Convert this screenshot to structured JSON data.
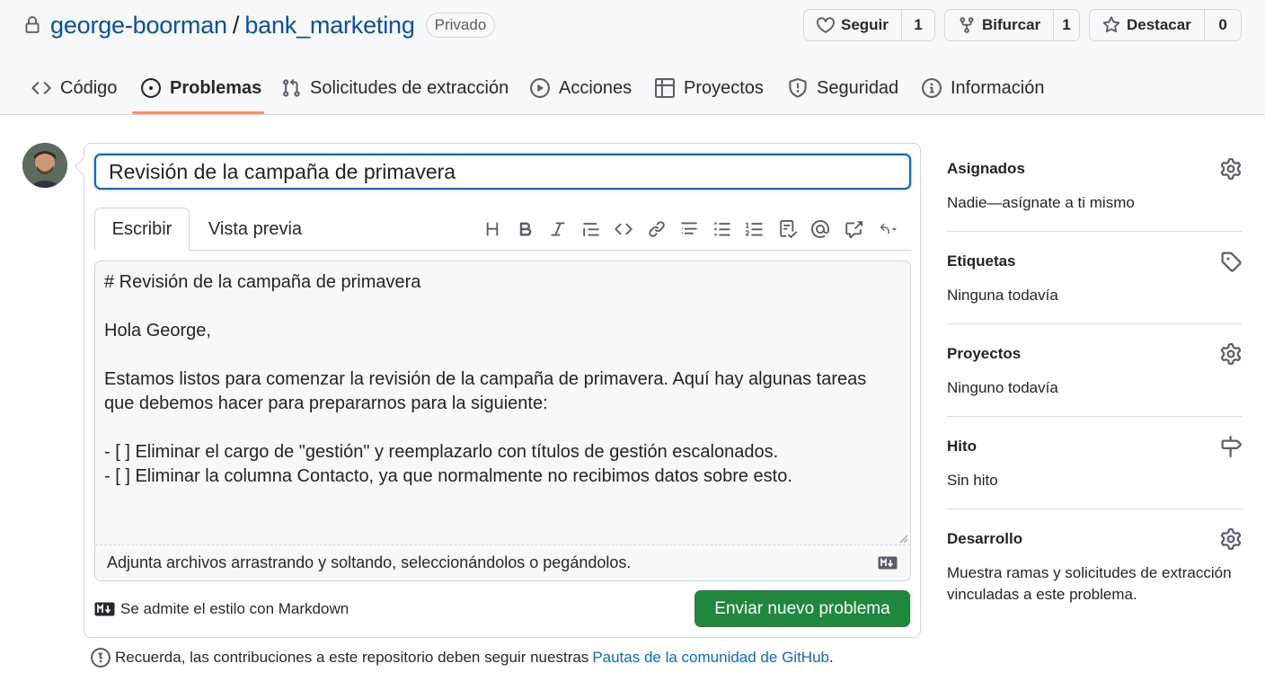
{
  "repo": {
    "owner": "george-boorman",
    "separator": "/",
    "name": "bank_marketing",
    "visibility": "Privado"
  },
  "actions": {
    "watch_label": "Seguir",
    "watch_count": "1",
    "fork_label": "Bifurcar",
    "fork_count": "1",
    "star_label": "Destacar",
    "star_count": "0"
  },
  "tabs": [
    {
      "label": "Código",
      "icon": "code-icon"
    },
    {
      "label": "Problemas",
      "icon": "issue-opened-icon",
      "active": true
    },
    {
      "label": "Solicitudes de extracción",
      "icon": "git-pull-request-icon"
    },
    {
      "label": "Acciones",
      "icon": "play-icon"
    },
    {
      "label": "Proyectos",
      "icon": "table-icon"
    },
    {
      "label": "Seguridad",
      "icon": "shield-icon"
    },
    {
      "label": "Información",
      "icon": "info-icon"
    }
  ],
  "issue": {
    "title_value": "Revisión de la campaña de primavera",
    "write_tab": "Escribir",
    "preview_tab": "Vista previa",
    "body": "# Revisión de la campaña de primavera\n\nHola George,\n\nEstamos listos para comenzar la revisión de la campaña de primavera. Aquí hay algunas tareas que debemos hacer para prepararnos para la siguiente:\n\n- [ ] Eliminar el cargo de \"gestión\" y reemplazarlo con títulos de gestión escalonados.\n- [ ] Eliminar la columna Contacto, ya que normalmente no recibimos datos sobre esto.",
    "attach_hint": "Adjunta archivos arrastrando y soltando, seleccionándolos o pegándolos.",
    "markdown_note": "Se admite el estilo con Markdown",
    "submit_label": "Enviar nuevo problema"
  },
  "toolbar_icons": [
    "heading-icon",
    "bold-icon",
    "italic-icon",
    "quote-icon",
    "code-icon",
    "link-icon",
    "ordered-list-icon",
    "unordered-list-icon",
    "numbered-list-icon",
    "tasklist-icon",
    "mention-icon",
    "cross-reference-icon",
    "undo-icon"
  ],
  "guidelines": {
    "text": "Recuerda, las contribuciones a este repositorio deben seguir nuestras",
    "link": "Pautas de la comunidad de GitHub",
    "suffix": "."
  },
  "sidebar": {
    "assignees": {
      "title": "Asignados",
      "value": "Nadie—asígnate a ti mismo"
    },
    "labels": {
      "title": "Etiquetas",
      "value": "Ninguna todavía"
    },
    "projects": {
      "title": "Proyectos",
      "value": "Ninguno todavía"
    },
    "milestone": {
      "title": "Hito",
      "value": "Sin hito"
    },
    "development": {
      "title": "Desarrollo",
      "value_line1": "Muestra ramas y solicitudes de extracción",
      "value_line2": "vinculadas a este problema."
    }
  },
  "colors": {
    "accent": "#0969da",
    "submit": "#1f883d",
    "tab_underline": "#fd8c73"
  }
}
